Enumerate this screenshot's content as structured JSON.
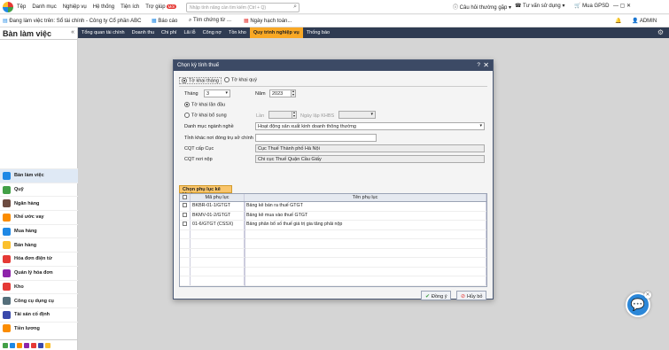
{
  "menubar": {
    "items": [
      "Tệp",
      "Danh mục",
      "Nghiệp vụ",
      "Hệ thống",
      "Tiện ích",
      "Trợ giúp"
    ],
    "new_badge": "Mới",
    "search_placeholder": "Nhập tính năng cần tìm kiếm (Ctrl + Q)",
    "faq": "Câu hỏi thường gặp",
    "consult": "Tư vấn sử dụng",
    "buy": "Mua GPSD",
    "user": "ADMIN"
  },
  "toolbar2": {
    "working_on": "Đang làm việc trên: Sổ tài chính - Công ty Cổ phần ABC",
    "report": "Báo cáo",
    "find_doc": "Tìm chứng từ ...",
    "posting_date": "Ngày hạch toán..."
  },
  "sidebar": {
    "title": "Bàn làm việc",
    "items": [
      {
        "label": "Bàn làm việc",
        "color": "#1e88e5"
      },
      {
        "label": "Quỹ",
        "color": "#43a047"
      },
      {
        "label": "Ngân hàng",
        "color": "#6d4c41"
      },
      {
        "label": "Khế ước vay",
        "color": "#fb8c00"
      },
      {
        "label": "Mua hàng",
        "color": "#1e88e5"
      },
      {
        "label": "Bán hàng",
        "color": "#fbc02d"
      },
      {
        "label": "Hóa đơn điện tử",
        "color": "#e53935"
      },
      {
        "label": "Quản lý hóa đơn",
        "color": "#8e24aa"
      },
      {
        "label": "Kho",
        "color": "#e53935"
      },
      {
        "label": "Công cụ dụng cụ",
        "color": "#546e7a"
      },
      {
        "label": "Tài sản cố định",
        "color": "#3949ab"
      },
      {
        "label": "Tiền lương",
        "color": "#fb8c00"
      }
    ]
  },
  "tabs": [
    "Tổng quan tài chính",
    "Doanh thu",
    "Chi phí",
    "Lãi lỗ",
    "Công nợ",
    "Tồn kho",
    "Quy trình nghiệp vụ",
    "Thống báo"
  ],
  "active_tab": "Quy trình nghiệp vụ",
  "dialog": {
    "title": "Chọn kỳ tính thuế",
    "help": "?",
    "close": "✕",
    "period_monthly": "Tờ khai tháng",
    "period_quarterly": "Tờ khai quý",
    "month_label": "Tháng",
    "month_value": "3",
    "year_label": "Năm",
    "year_value": "2023",
    "first_filing": "Tờ khai lần đầu",
    "supplementary": "Tờ khai bổ sung",
    "times_label": "Lần",
    "kh_date_label": "Ngày lập KHBS",
    "industry_label": "Danh mục ngành nghề",
    "industry_value": "Hoạt động sản xuất kinh doanh thông thường",
    "province_label": "Tỉnh khác nơi đóng trụ sở chính",
    "cqt_dept_label": "CQT cấp Cục",
    "cqt_dept_value": "Cục Thuế Thành phố Hà Nội",
    "cqt_submit_label": "CQT nơi nộp",
    "cqt_submit_value": "Chi cục Thuế Quận Cầu Giấy",
    "sub_tab": "Chọn phụ lục kê khai",
    "grid_headers": [
      "Mã phụ lục",
      "Tên phụ lục"
    ],
    "rows": [
      {
        "code": "BKBR-01-1/GTGT",
        "name": "Bảng kê bán ra thuế GTGT"
      },
      {
        "code": "BKMV-01-2/GTGT",
        "name": "Bảng kê mua vào thuế GTGT"
      },
      {
        "code": "01-6/GTGT (CSSX)",
        "name": "Bảng phân bổ số thuế giá trị gia tăng phải nộp"
      }
    ],
    "ok": "Đồng ý",
    "cancel": "Hủy bỏ"
  }
}
